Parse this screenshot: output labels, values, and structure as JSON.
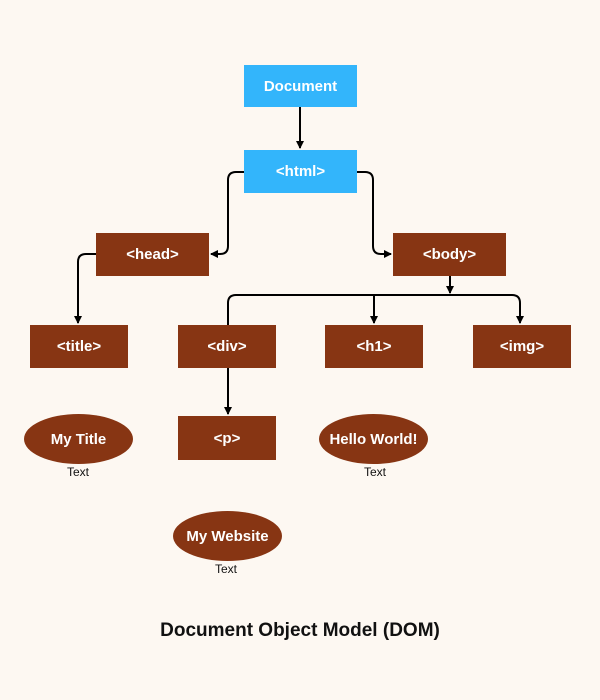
{
  "diagram": {
    "title": "Document Object Model (DOM)",
    "colors": {
      "root": "#33b5fb",
      "element": "#873513",
      "edge": "#000000",
      "background": "#fdf8f2"
    },
    "nodes": {
      "document": "Document",
      "html": "<html>",
      "head": "<head>",
      "body": "<body>",
      "title": "<title>",
      "div": "<div>",
      "h1": "<h1>",
      "img": "<img>",
      "p": "<p>"
    },
    "text_nodes": {
      "my_title": {
        "value": "My Title",
        "label": "Text"
      },
      "hello_world": {
        "value": "Hello World!",
        "label": "Text"
      },
      "my_website": {
        "value": "My Website",
        "label": "Text"
      }
    },
    "edges": [
      [
        "Document",
        "<html>"
      ],
      [
        "<html>",
        "<head>"
      ],
      [
        "<html>",
        "<body>"
      ],
      [
        "<head>",
        "<title>"
      ],
      [
        "<body>",
        "<div>"
      ],
      [
        "<body>",
        "<h1>"
      ],
      [
        "<body>",
        "<img>"
      ],
      [
        "<div>",
        "<p>"
      ]
    ]
  }
}
